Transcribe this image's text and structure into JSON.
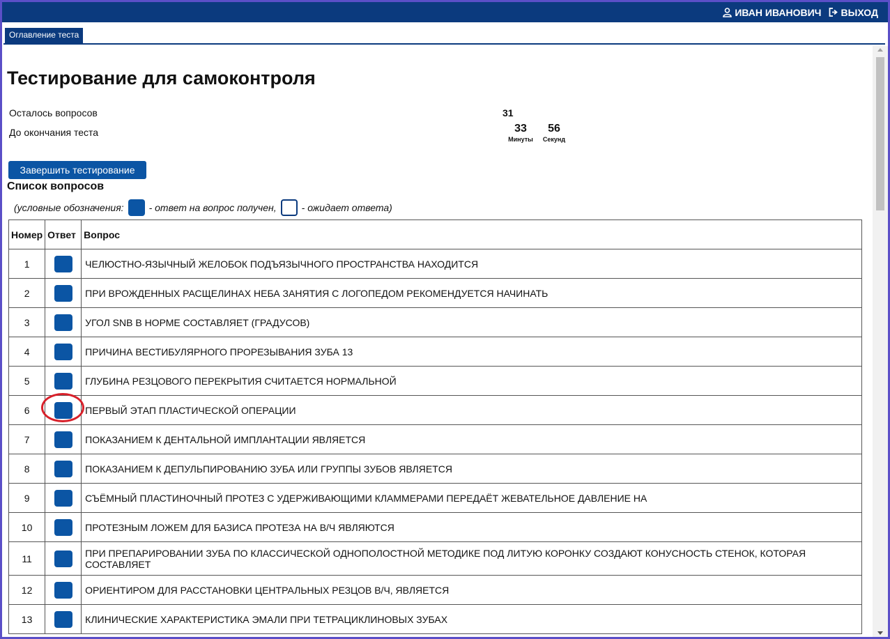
{
  "topbar": {
    "user_name": "ИВАН ИВАНОВИЧ",
    "logout_label": "ВЫХОД",
    "background": "#0b3a7e"
  },
  "tab": {
    "label": "Оглавление теста"
  },
  "page": {
    "title": "Тестирование для самоконтроля",
    "remaining_label": "Осталось вопросов",
    "remaining_value": "31",
    "timer_label": "До окончания теста",
    "minutes_value": "33",
    "minutes_unit": "Минуты",
    "seconds_value": "56",
    "seconds_unit": "Секунд",
    "finish_button": "Завершить тестирование",
    "questions_title": "Список вопросов",
    "legend": {
      "prefix": "(условные обозначения:",
      "answered": "- ответ на вопрос получен,",
      "pending": "- ожидает ответа)"
    },
    "accent": "#0b55a4"
  },
  "table": {
    "headers": [
      "Номер",
      "Ответ",
      "Вопрос"
    ],
    "rows": [
      {
        "num": "1",
        "answered": true,
        "text": "ЧЕЛЮСТНО-ЯЗЫЧНЫЙ ЖЕЛОБОК ПОДЪЯЗЫЧНОГО ПРОСТРАНСТВА НАХОДИТСЯ"
      },
      {
        "num": "2",
        "answered": true,
        "text": "ПРИ ВРОЖДЕННЫХ РАСЩЕЛИНАХ НЕБА ЗАНЯТИЯ С ЛОГОПЕДОМ РЕКОМЕНДУЕТСЯ НАЧИНАТЬ"
      },
      {
        "num": "3",
        "answered": true,
        "text": "УГОЛ SNB В НОРМЕ СОСТАВЛЯЕТ (ГРАДУСОВ)"
      },
      {
        "num": "4",
        "answered": true,
        "text": "ПРИЧИНА ВЕСТИБУЛЯРНОГО ПРОРЕЗЫВАНИЯ ЗУБА 13"
      },
      {
        "num": "5",
        "answered": true,
        "text": "ГЛУБИНА РЕЗЦОВОГО ПЕРЕКРЫТИЯ СЧИТАЕТСЯ НОРМАЛЬНОЙ"
      },
      {
        "num": "6",
        "answered": true,
        "text": "ПЕРВЫЙ ЭТАП ПЛАСТИЧЕСКОЙ ОПЕРАЦИИ"
      },
      {
        "num": "7",
        "answered": true,
        "text": "ПОКАЗАНИЕМ К ДЕНТАЛЬНОЙ ИМПЛАНТАЦИИ ЯВЛЯЕТСЯ"
      },
      {
        "num": "8",
        "answered": true,
        "text": "ПОКАЗАНИЕМ К ДЕПУЛЬПИРОВАНИЮ ЗУБА ИЛИ ГРУППЫ ЗУБОВ ЯВЛЯЕТСЯ"
      },
      {
        "num": "9",
        "answered": true,
        "text": "СЪЁМНЫЙ ПЛАСТИНОЧНЫЙ ПРОТЕЗ С УДЕРЖИВАЮЩИМИ КЛАММЕРАМИ ПЕРЕДАЁТ ЖЕВАТЕЛЬНОЕ ДАВЛЕНИЕ НА"
      },
      {
        "num": "10",
        "answered": true,
        "text": "ПРОТЕЗНЫМ ЛОЖЕМ ДЛЯ БАЗИСА ПРОТЕЗА НА В/Ч ЯВЛЯЮТСЯ"
      },
      {
        "num": "11",
        "answered": true,
        "text": "ПРИ ПРЕПАРИРОВАНИИ ЗУБА ПО КЛАССИЧЕСКОЙ ОДНОПОЛОСТНОЙ МЕТОДИКЕ ПОД ЛИТУЮ КОРОНКУ СОЗДАЮТ КОНУСНОСТЬ СТЕНОК, КОТОРАЯ СОСТАВЛЯЕТ"
      },
      {
        "num": "12",
        "answered": true,
        "text": "ОРИЕНТИРОМ ДЛЯ РАССТАНОВКИ ЦЕНТРАЛЬНЫХ РЕЗЦОВ В/Ч, ЯВЛЯЕТСЯ"
      },
      {
        "num": "13",
        "answered": true,
        "text": "КЛИНИЧЕСКИЕ ХАРАКТЕРИСТИКА ЭМАЛИ ПРИ ТЕТРАЦИКЛИНОВЫХ ЗУБАХ"
      }
    ]
  }
}
